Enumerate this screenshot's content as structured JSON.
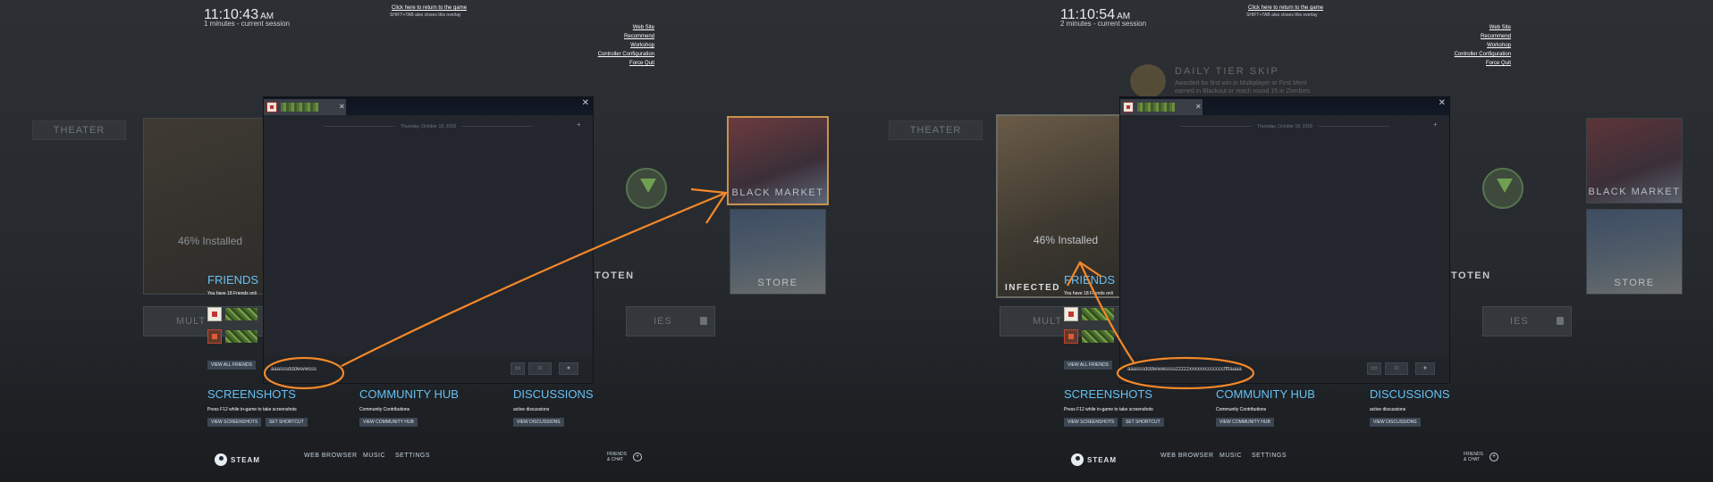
{
  "left": {
    "clock": {
      "time": "11:10:43",
      "ampm": "AM",
      "session": "1 minutes - current session"
    },
    "chat_input_value": "aaasssdddwwwsss",
    "installed": "46% Installed"
  },
  "right": {
    "clock": {
      "time": "11:10:54",
      "ampm": "AM",
      "session": "2 minutes - current session"
    },
    "chat_input_value": "aaasssdddwwwsssszzzzzxxxxxxcccccccffffaaaa",
    "installed": "46% Installed",
    "infected": "INFECTED",
    "daily": {
      "title": "DAILY TIER SKIP",
      "desc": "Awarded for first win in Multiplayer or First Merit earned in Blackout or reach round 15 in Zombies Classic"
    }
  },
  "overlay": {
    "return_link": "Click here to return to the game",
    "return_hint": "SHIFT+TAB also closes this overlay",
    "links": [
      "Web Site",
      "Recommend",
      "Workshop",
      "Controller Configuration",
      "Force Quit"
    ]
  },
  "game": {
    "theater": "THEATER",
    "black_market": "BLACK MARKET",
    "store": "STORE",
    "totem": "TOTEN",
    "mult": "MULT",
    "ies": "IES"
  },
  "chat": {
    "date": "Thursday, October 18, 2018"
  },
  "friends": {
    "title": "FRIENDS",
    "subtitle": "You have 18 Friends onli",
    "view_all": "VIEW ALL FRIENDS"
  },
  "screenshots": {
    "title": "SCREENSHOTS",
    "subtitle": "Press F12 while in-game to take screenshots",
    "btn_view": "VIEW SCREENSHOTS",
    "btn_shortcut": "SET SHORTCUT"
  },
  "community": {
    "title": "COMMUNITY HUB",
    "subtitle": "Community Contributions",
    "btn": "VIEW COMMUNITY HUB"
  },
  "discussions": {
    "title": "DISCUSSIONS",
    "subtitle": "active discussions",
    "btn": "VIEW DISCUSSIONS"
  },
  "bottom": {
    "steam": "STEAM",
    "web_browser": "WEB BROWSER",
    "music": "MUSIC",
    "settings": "SETTINGS",
    "friends_chat_1": "FRIENDS",
    "friends_chat_2": "& CHAT"
  },
  "colors": {
    "annotation": "#f4882a",
    "accent_blue": "#66c0f4"
  }
}
